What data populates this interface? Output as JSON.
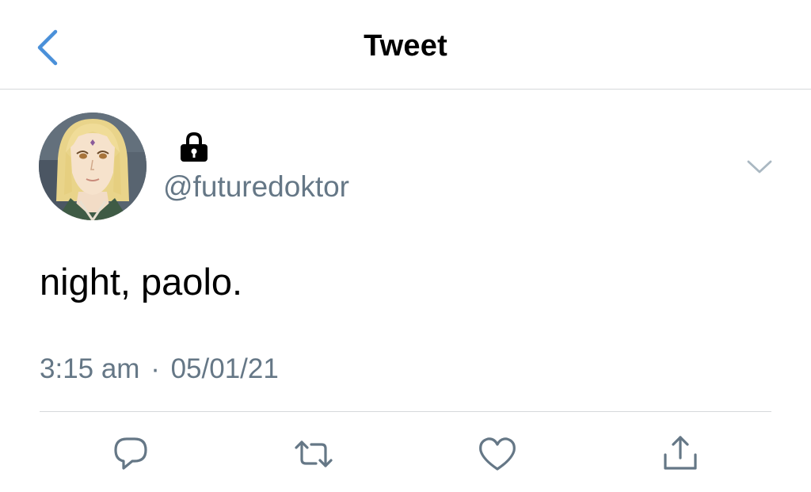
{
  "header": {
    "title": "Tweet",
    "back_icon": "chevron-left-icon"
  },
  "tweet": {
    "avatar_icon": "profile-avatar",
    "protected_icon": "lock-icon",
    "handle": "@futuredoktor",
    "more_icon": "chevron-down-icon",
    "text": "night, paolo.",
    "time": "3:15 am",
    "separator": "·",
    "date": "05/01/21"
  },
  "actions": [
    {
      "name": "reply",
      "icon": "reply-icon"
    },
    {
      "name": "retweet",
      "icon": "retweet-icon"
    },
    {
      "name": "like",
      "icon": "heart-icon"
    },
    {
      "name": "share",
      "icon": "share-icon"
    }
  ],
  "colors": {
    "accent": "#1da1f2",
    "secondary_text": "#657786",
    "divider": "#d6d9db",
    "primary_text": "#000000"
  }
}
